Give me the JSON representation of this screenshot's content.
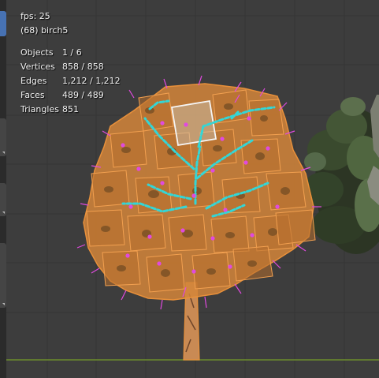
{
  "overlay": {
    "fps": "fps: 25",
    "object_name": "(68) birch5"
  },
  "stats": [
    {
      "label": "Objects",
      "value": "1 / 6"
    },
    {
      "label": "Vertices",
      "value": "858 / 858"
    },
    {
      "label": "Edges",
      "value": "1,212 / 1,212"
    },
    {
      "label": "Faces",
      "value": "489 / 489"
    },
    {
      "label": "Triangles",
      "value": "851"
    }
  ],
  "colors": {
    "viewport_bg": "#3d3d3d",
    "grid_line": "#353535",
    "horizon_line": "#6d8d2c",
    "selection_orange": "#e8903a",
    "active_face_white": "#f5f5f5",
    "vertex_magenta": "#e04adf",
    "seam_cyan": "#33d6d6",
    "toolbar_active": "#4772b3"
  },
  "icons": {
    "active_tool": "select-box-icon"
  }
}
